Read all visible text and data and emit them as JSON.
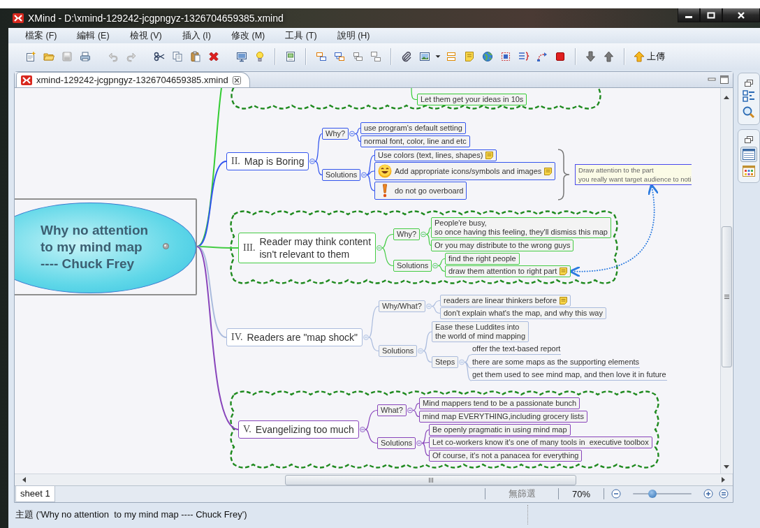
{
  "window": {
    "title": "XMind - D:\\xmind-129242-jcgpngyz-1326704659385.xmind"
  },
  "menu": [
    "檔案 (F)",
    "編輯 (E)",
    "檢視 (V)",
    "插入 (I)",
    "修改 (M)",
    "工具 (T)",
    "說明 (H)"
  ],
  "toolbar": {
    "upload_label": "上傳"
  },
  "editor_tab": {
    "title": "xmind-129242-jcgpngyz-1326704659385.xmind"
  },
  "map": {
    "central": {
      "title": "Why no attention\nto my mind map\n---- Chuck Frey",
      "selected": true
    },
    "top_fragment": {
      "color": "#33cc33",
      "boundary": true,
      "children": [
        {
          "title": "Let them get your ideas in 10s"
        }
      ]
    },
    "topics": [
      {
        "number": "II.",
        "title": "Map is Boring",
        "color": "#3355ee",
        "children": [
          {
            "title": "Why?",
            "children": [
              {
                "title": "use program's default setting"
              },
              {
                "title": "normal font, color, line and etc"
              }
            ]
          },
          {
            "title": "Solutions",
            "children": [
              {
                "title": "Use colors (text, lines, shapes)",
                "kind": "plain",
                "note": true
              },
              {
                "title": "Add appropriate icons/symbols and images",
                "kind": "smiley",
                "note": true
              },
              {
                "title": "do not go overboard",
                "kind": "exclamation"
              }
            ]
          }
        ],
        "summary": {
          "title": "Draw attention to the part\nyou really want target audience to noti"
        }
      },
      {
        "number": "III.",
        "title": "Reader may think content\nisn't relevant to them",
        "color": "#44cc44",
        "boundary": true,
        "children": [
          {
            "title": "Why?",
            "children": [
              {
                "title": "People're busy,\nso once having this feeling, they'll dismiss this map"
              },
              {
                "title": "Or you may distribute to the wrong guys"
              }
            ]
          },
          {
            "title": "Solutions",
            "children": [
              {
                "title": "find the right people"
              },
              {
                "title": "draw them attention to right part",
                "note": true
              }
            ]
          }
        ]
      },
      {
        "number": "IV.",
        "title": "Readers are \"map shock\"",
        "color": "#aabbdd",
        "children": [
          {
            "title": "Why/What?",
            "children": [
              {
                "title": "readers are linear thinkers before",
                "note": true
              },
              {
                "title": "don't explain what's the map, and why this way"
              }
            ]
          },
          {
            "title": "Solutions",
            "children": [
              {
                "title": "Ease these Luddites into\nthe world of mind mapping"
              },
              {
                "title": "Steps",
                "children": [
                  {
                    "title": "offer the text-based report",
                    "kind": "underline"
                  },
                  {
                    "title": "there are some maps as the supporting elements",
                    "kind": "underline"
                  },
                  {
                    "title": "get them used to see mind map, and then love it in future",
                    "kind": "underline"
                  }
                ]
              }
            ]
          }
        ]
      },
      {
        "number": "V.",
        "title": "Evangelizing too much",
        "color": "#8844bb",
        "boundary": true,
        "children": [
          {
            "title": "What?",
            "children": [
              {
                "title": "Mind mappers tend to be a passionate bunch"
              },
              {
                "title": "mind map EVERYTHING,including grocery lists"
              }
            ]
          },
          {
            "title": "Solutions",
            "children": [
              {
                "title": "Be openly pragmatic in using mind map"
              },
              {
                "title": "Let co-workers know it's one of many tools in  executive toolbox"
              },
              {
                "title": "Of course, it's not a panacea for everything"
              }
            ]
          }
        ]
      }
    ]
  },
  "sheets": [
    {
      "label": "sheet 1",
      "selected": true
    }
  ],
  "filter": "無篩選",
  "zoom": {
    "label": "70%",
    "level": 0.33
  },
  "status": "主題 ('Why no attention  to my mind map ---- Chuck Frey')"
}
